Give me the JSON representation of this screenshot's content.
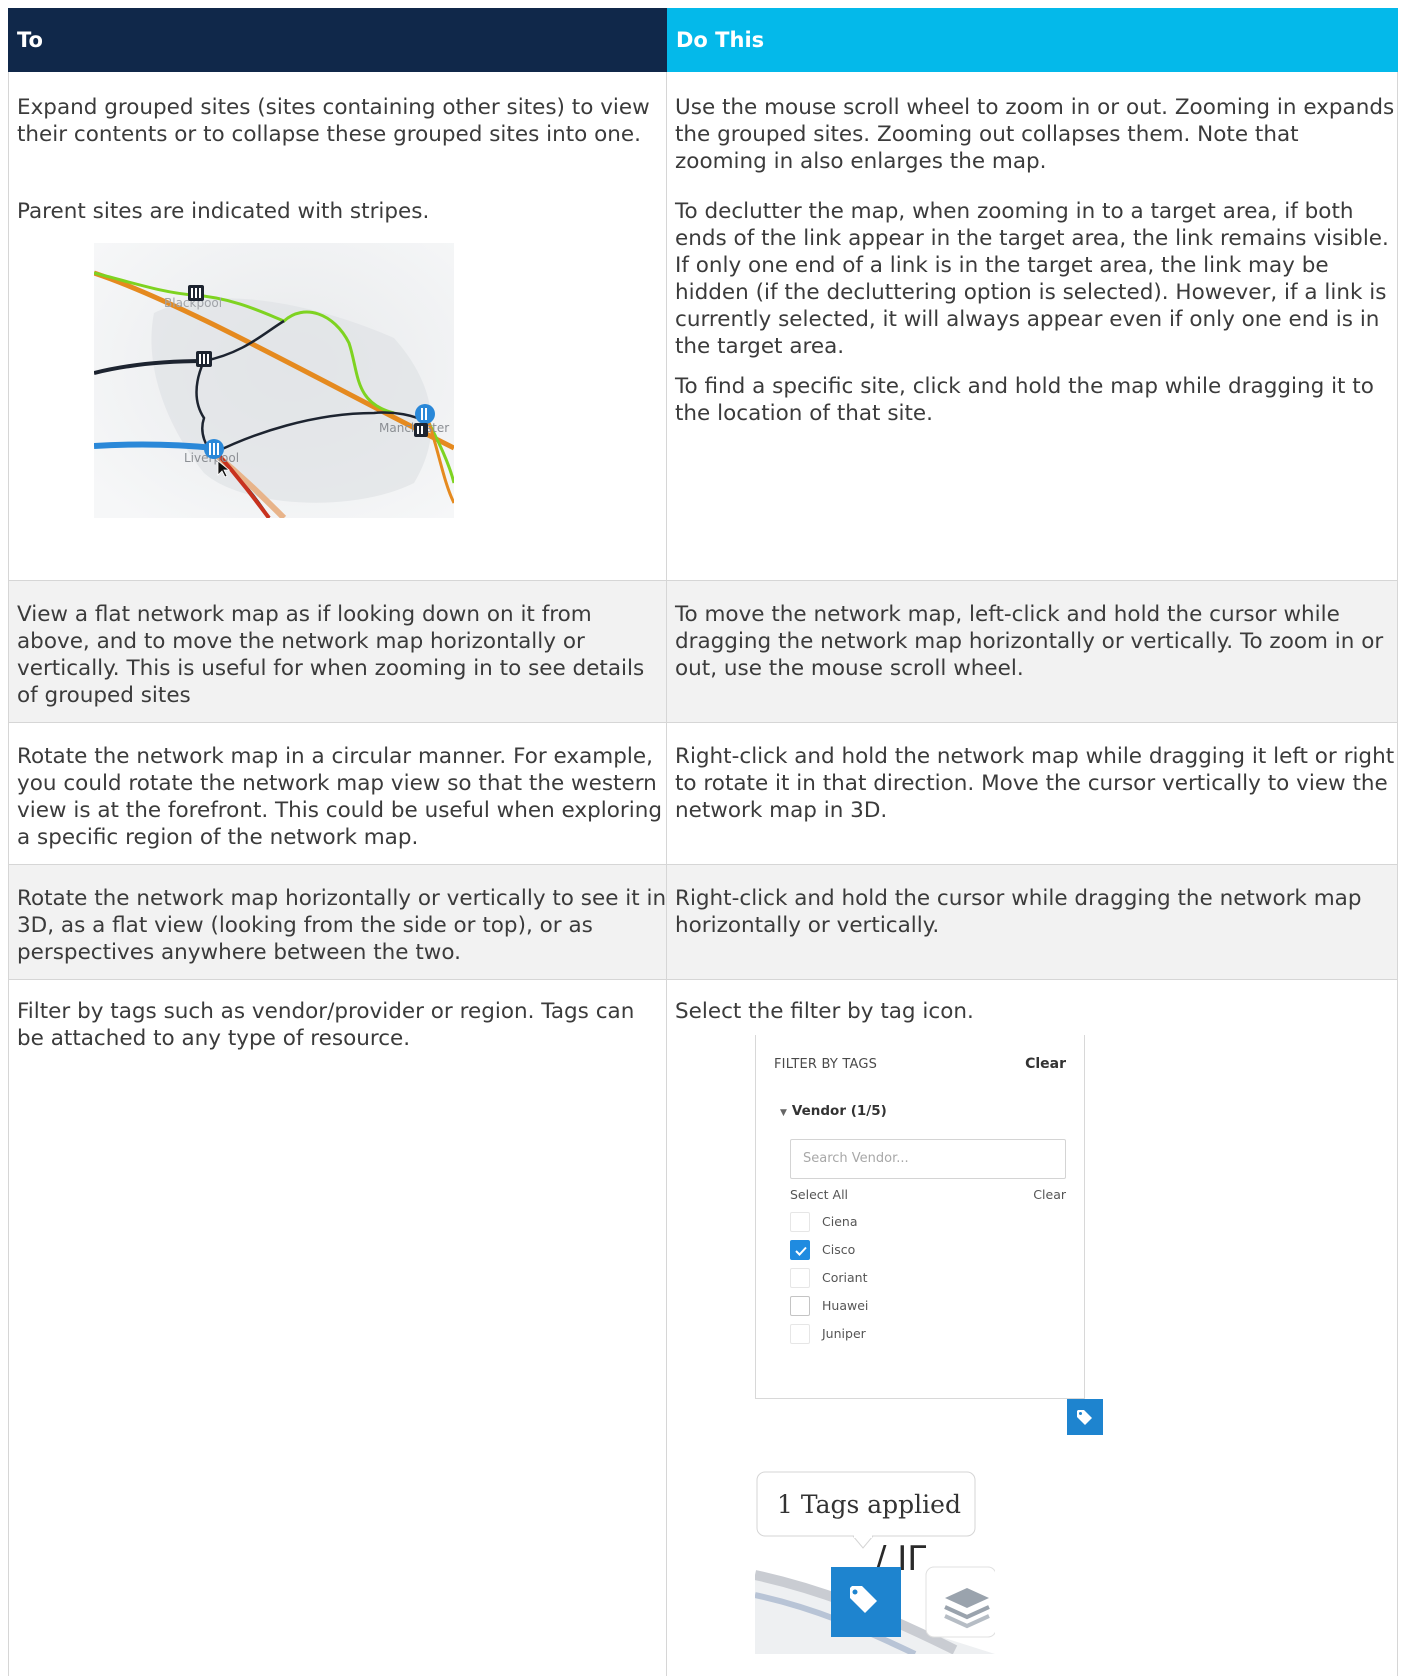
{
  "table": {
    "header": {
      "col1": "To",
      "col2": "Do This"
    },
    "rows": [
      {
        "to": [
          "Expand grouped sites (sites containing other sites) to view their contents or to collapse these grouped sites into one.",
          "Parent sites are indicated with stripes."
        ],
        "do": [
          "Use the mouse scroll wheel to zoom in or out. Zooming in expands the grouped sites. Zooming out collapses them. Note that zooming in also enlarges the map.",
          "To declutter the map, when zooming in to a target area, if both ends of the link appear in the target area, the link remains visible. If only one end of a link is in the target area, the link may be hidden (if the decluttering option is selected). However, if a link is currently selected, it will always appear even if only one end is in the target area.",
          "To find a specific site, click and hold the map while dragging it to the location of that site."
        ]
      },
      {
        "to": [
          "View a flat network map as if looking down on it from above, and to move the network map horizontally or vertically. This is useful for when zooming in to see details of grouped sites"
        ],
        "do": [
          "To move the network map, left-click and hold the cursor while dragging the network map horizontally or vertically. To zoom in or out, use the mouse scroll wheel."
        ]
      },
      {
        "to": [
          "Rotate the network map in a circular manner. For example, you could rotate the network map view so that the western view is at the forefront. This could be useful when exploring a specific region of the network map."
        ],
        "do": [
          "Right-click and hold the network map while dragging it left or right to rotate it in that direction. Move the cursor vertically to view the network map in 3D."
        ]
      },
      {
        "to": [
          "Rotate the network map horizontally or vertically to see it in 3D, as a flat view (looking from the side or top), or as perspectives anywhere between the two."
        ],
        "do": [
          "Right-click and hold the cursor while dragging the network map horizontally or vertically."
        ]
      },
      {
        "to": [
          "Filter by tags such as vendor/provider or region. Tags can be attached to any type of resource."
        ],
        "do": [
          "Select the filter by tag icon."
        ]
      }
    ]
  },
  "map_image": {
    "labels": {
      "blackpool": "Blackpool",
      "manchester": "Manchester",
      "liverpool": "Liverpool"
    }
  },
  "filter_panel": {
    "title": "FILTER BY TAGS",
    "clear": "Clear",
    "group": "Vendor (1/5)",
    "search_placeholder": "Search Vendor...",
    "select_all": "Select All",
    "clear_small": "Clear",
    "options": [
      {
        "label": "Ciena",
        "checked": false
      },
      {
        "label": "Cisco",
        "checked": true
      },
      {
        "label": "Coriant",
        "checked": false
      },
      {
        "label": "Huawei",
        "checked": false
      },
      {
        "label": "Juniper",
        "checked": false
      }
    ]
  },
  "tags_applied": {
    "text": "1 Tags applied"
  },
  "colors": {
    "header_dark": "#10284a",
    "header_cyan": "#04b9ea",
    "link_orange": "#e58a1f",
    "link_green": "#7ed321",
    "link_blue": "#2a88d8",
    "link_red": "#c8321e",
    "tag_blue": "#1e84cf"
  }
}
